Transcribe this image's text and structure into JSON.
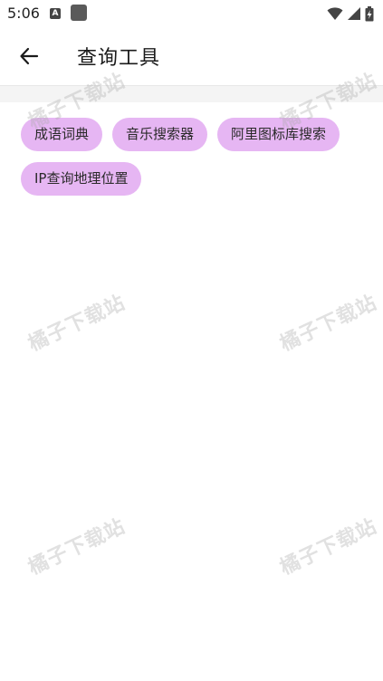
{
  "status_bar": {
    "time": "5:06",
    "notification_icon_letter": "A"
  },
  "app_bar": {
    "title": "查询工具"
  },
  "tools": [
    {
      "label": "成语词典"
    },
    {
      "label": "音乐搜索器"
    },
    {
      "label": "阿里图标库搜索"
    },
    {
      "label": "IP查询地理位置"
    }
  ],
  "watermark": {
    "text": "橘子下载站"
  },
  "colors": {
    "chip_background": "#e6b6f3",
    "band_background": "#f4f4f4"
  }
}
